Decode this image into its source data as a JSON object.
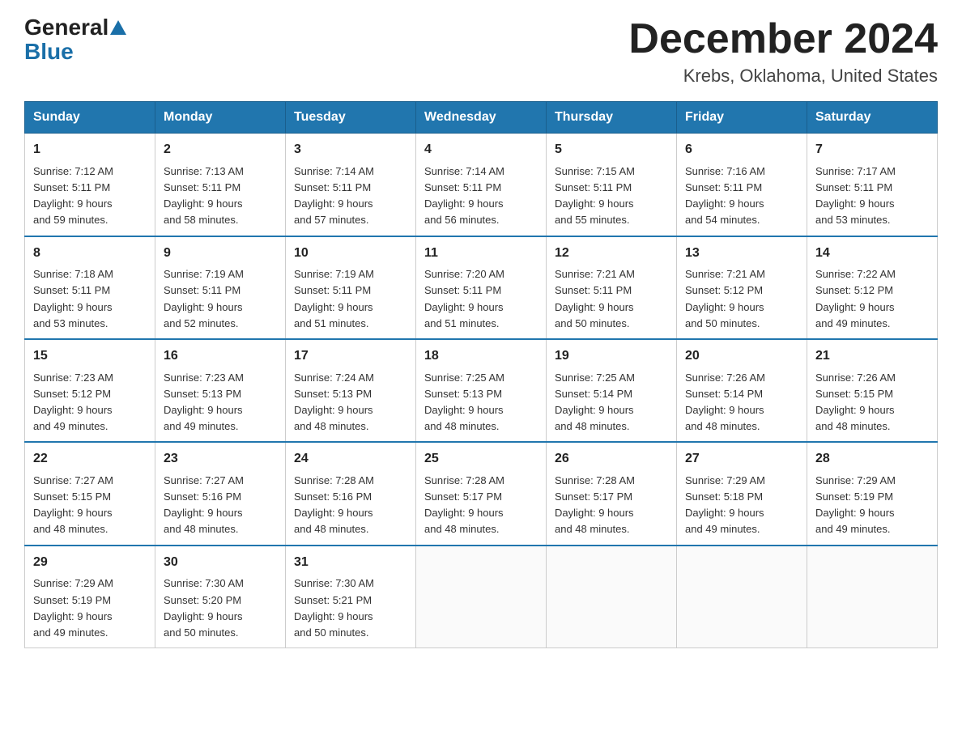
{
  "logo": {
    "general": "General",
    "blue": "Blue"
  },
  "header": {
    "month_title": "December 2024",
    "location": "Krebs, Oklahoma, United States"
  },
  "weekdays": [
    "Sunday",
    "Monday",
    "Tuesday",
    "Wednesday",
    "Thursday",
    "Friday",
    "Saturday"
  ],
  "weeks": [
    [
      {
        "day": "1",
        "sunrise": "7:12 AM",
        "sunset": "5:11 PM",
        "daylight": "9 hours and 59 minutes."
      },
      {
        "day": "2",
        "sunrise": "7:13 AM",
        "sunset": "5:11 PM",
        "daylight": "9 hours and 58 minutes."
      },
      {
        "day": "3",
        "sunrise": "7:14 AM",
        "sunset": "5:11 PM",
        "daylight": "9 hours and 57 minutes."
      },
      {
        "day": "4",
        "sunrise": "7:14 AM",
        "sunset": "5:11 PM",
        "daylight": "9 hours and 56 minutes."
      },
      {
        "day": "5",
        "sunrise": "7:15 AM",
        "sunset": "5:11 PM",
        "daylight": "9 hours and 55 minutes."
      },
      {
        "day": "6",
        "sunrise": "7:16 AM",
        "sunset": "5:11 PM",
        "daylight": "9 hours and 54 minutes."
      },
      {
        "day": "7",
        "sunrise": "7:17 AM",
        "sunset": "5:11 PM",
        "daylight": "9 hours and 53 minutes."
      }
    ],
    [
      {
        "day": "8",
        "sunrise": "7:18 AM",
        "sunset": "5:11 PM",
        "daylight": "9 hours and 53 minutes."
      },
      {
        "day": "9",
        "sunrise": "7:19 AM",
        "sunset": "5:11 PM",
        "daylight": "9 hours and 52 minutes."
      },
      {
        "day": "10",
        "sunrise": "7:19 AM",
        "sunset": "5:11 PM",
        "daylight": "9 hours and 51 minutes."
      },
      {
        "day": "11",
        "sunrise": "7:20 AM",
        "sunset": "5:11 PM",
        "daylight": "9 hours and 51 minutes."
      },
      {
        "day": "12",
        "sunrise": "7:21 AM",
        "sunset": "5:11 PM",
        "daylight": "9 hours and 50 minutes."
      },
      {
        "day": "13",
        "sunrise": "7:21 AM",
        "sunset": "5:12 PM",
        "daylight": "9 hours and 50 minutes."
      },
      {
        "day": "14",
        "sunrise": "7:22 AM",
        "sunset": "5:12 PM",
        "daylight": "9 hours and 49 minutes."
      }
    ],
    [
      {
        "day": "15",
        "sunrise": "7:23 AM",
        "sunset": "5:12 PM",
        "daylight": "9 hours and 49 minutes."
      },
      {
        "day": "16",
        "sunrise": "7:23 AM",
        "sunset": "5:13 PM",
        "daylight": "9 hours and 49 minutes."
      },
      {
        "day": "17",
        "sunrise": "7:24 AM",
        "sunset": "5:13 PM",
        "daylight": "9 hours and 48 minutes."
      },
      {
        "day": "18",
        "sunrise": "7:25 AM",
        "sunset": "5:13 PM",
        "daylight": "9 hours and 48 minutes."
      },
      {
        "day": "19",
        "sunrise": "7:25 AM",
        "sunset": "5:14 PM",
        "daylight": "9 hours and 48 minutes."
      },
      {
        "day": "20",
        "sunrise": "7:26 AM",
        "sunset": "5:14 PM",
        "daylight": "9 hours and 48 minutes."
      },
      {
        "day": "21",
        "sunrise": "7:26 AM",
        "sunset": "5:15 PM",
        "daylight": "9 hours and 48 minutes."
      }
    ],
    [
      {
        "day": "22",
        "sunrise": "7:27 AM",
        "sunset": "5:15 PM",
        "daylight": "9 hours and 48 minutes."
      },
      {
        "day": "23",
        "sunrise": "7:27 AM",
        "sunset": "5:16 PM",
        "daylight": "9 hours and 48 minutes."
      },
      {
        "day": "24",
        "sunrise": "7:28 AM",
        "sunset": "5:16 PM",
        "daylight": "9 hours and 48 minutes."
      },
      {
        "day": "25",
        "sunrise": "7:28 AM",
        "sunset": "5:17 PM",
        "daylight": "9 hours and 48 minutes."
      },
      {
        "day": "26",
        "sunrise": "7:28 AM",
        "sunset": "5:17 PM",
        "daylight": "9 hours and 48 minutes."
      },
      {
        "day": "27",
        "sunrise": "7:29 AM",
        "sunset": "5:18 PM",
        "daylight": "9 hours and 49 minutes."
      },
      {
        "day": "28",
        "sunrise": "7:29 AM",
        "sunset": "5:19 PM",
        "daylight": "9 hours and 49 minutes."
      }
    ],
    [
      {
        "day": "29",
        "sunrise": "7:29 AM",
        "sunset": "5:19 PM",
        "daylight": "9 hours and 49 minutes."
      },
      {
        "day": "30",
        "sunrise": "7:30 AM",
        "sunset": "5:20 PM",
        "daylight": "9 hours and 50 minutes."
      },
      {
        "day": "31",
        "sunrise": "7:30 AM",
        "sunset": "5:21 PM",
        "daylight": "9 hours and 50 minutes."
      },
      null,
      null,
      null,
      null
    ]
  ],
  "labels": {
    "sunrise": "Sunrise:",
    "sunset": "Sunset:",
    "daylight": "Daylight:"
  }
}
